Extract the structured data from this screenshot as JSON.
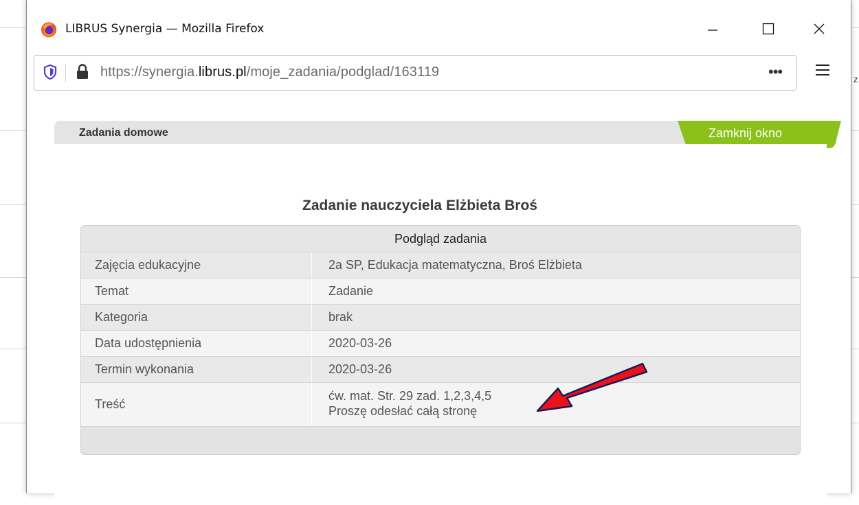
{
  "window": {
    "title": "LIBRUS Synergia — Mozilla Firefox",
    "url_prefix": "https://synergia.",
    "url_domain": "librus.pl",
    "url_path": "/moje_zadania/podglad/163119",
    "edge_text": "z"
  },
  "panel": {
    "title": "Zadania domowe",
    "close_label": "Zamknij okno",
    "heading": "Zadanie nauczyciela Elżbieta Broś",
    "accent_color": "#8bc11a"
  },
  "table": {
    "header": "Podgląd zadania",
    "rows": [
      {
        "label": "Zajęcia edukacyjne",
        "value": "2a SP, Edukacja matematyczna, Broś Elżbieta"
      },
      {
        "label": "Temat",
        "value": "Zadanie"
      },
      {
        "label": "Kategoria",
        "value": "brak"
      },
      {
        "label": "Data udostępnienia",
        "value": "2020-03-26"
      },
      {
        "label": "Termin wykonania",
        "value": "2020-03-26"
      },
      {
        "label": "Treść",
        "value_line1": "ćw. mat. Str. 29 zad. 1,2,3,4,5",
        "value_line2": "Proszę odesłać całą stronę"
      }
    ]
  },
  "annotation": {
    "arrow_color": "#e8131b"
  }
}
